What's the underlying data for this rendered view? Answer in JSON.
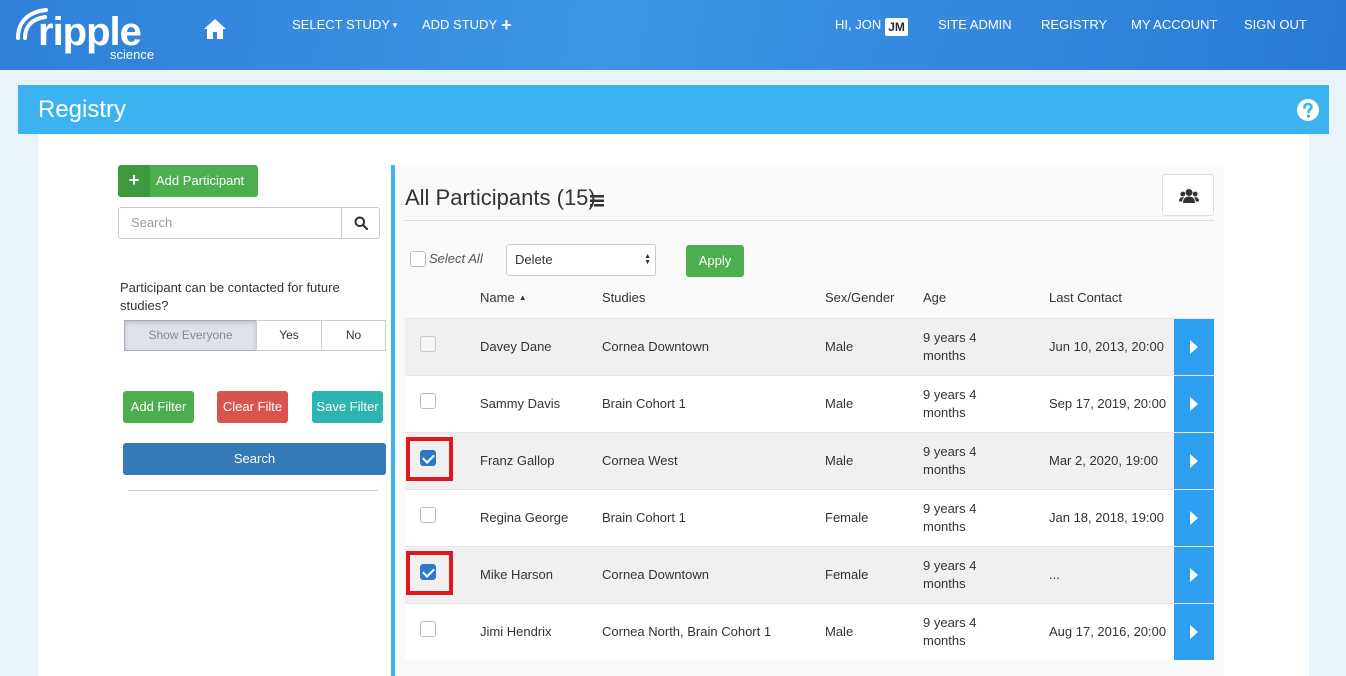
{
  "nav": {
    "logo_text": "ripple",
    "logo_sub": "science",
    "select_study": "SELECT STUDY",
    "add_study": "ADD STUDY",
    "greeting": "HI, JON",
    "initials": "JM",
    "site_admin": "SITE ADMIN",
    "registry": "REGISTRY",
    "my_account": "MY ACCOUNT",
    "sign_out": "SIGN OUT"
  },
  "page": {
    "title": "Registry"
  },
  "sidebar": {
    "add_participant": "Add Participant",
    "search_placeholder": "Search",
    "filter_label": "Participant can be contacted for future studies?",
    "filter_options": [
      "Show Everyone",
      "Yes",
      "No"
    ],
    "filter_selected": "Show Everyone",
    "add_filter": "Add Filter",
    "clear_filter": "Clear Filte",
    "save_filter": "Save Filter",
    "search_button": "Search"
  },
  "table": {
    "title": "All Participants (15)",
    "select_all": "Select All",
    "bulk_action": "Delete",
    "apply": "Apply",
    "columns": [
      "Name",
      "Studies",
      "Sex/Gender",
      "Age",
      "Last Contact"
    ],
    "sort_indicator": "▲",
    "rows": [
      {
        "name": "Davey Dane",
        "studies": "Cornea Downtown",
        "sex": "Male",
        "age": "9 years 4 months",
        "last_contact": "Jun 10, 2013, 20:00",
        "checked": false
      },
      {
        "name": "Sammy Davis",
        "studies": "Brain Cohort 1",
        "sex": "Male",
        "age": "9 years 4 months",
        "last_contact": "Sep 17, 2019, 20:00",
        "checked": false
      },
      {
        "name": "Franz Gallop",
        "studies": "Cornea West",
        "sex": "Male",
        "age": "9 years 4 months",
        "last_contact": "Mar 2, 2020, 19:00",
        "checked": true
      },
      {
        "name": "Regina George",
        "studies": "Brain Cohort 1",
        "sex": "Female",
        "age": "9 years 4 months",
        "last_contact": "Jan 18, 2018, 19:00",
        "checked": false
      },
      {
        "name": "Mike Harson",
        "studies": "Cornea Downtown",
        "sex": "Female",
        "age": "9 years 4 months",
        "last_contact": "...",
        "checked": true
      },
      {
        "name": "Jimi Hendrix",
        "studies": "Cornea North, Brain Cohort 1",
        "sex": "Male",
        "age": "9 years 4 months",
        "last_contact": "Aug 17, 2016, 20:00",
        "checked": false
      }
    ]
  },
  "colors": {
    "nav_blue": "#3d95e6",
    "header_blue": "#3cb3f0",
    "row_button_blue": "#2d9ef0",
    "highlight_red": "#e0171f"
  }
}
